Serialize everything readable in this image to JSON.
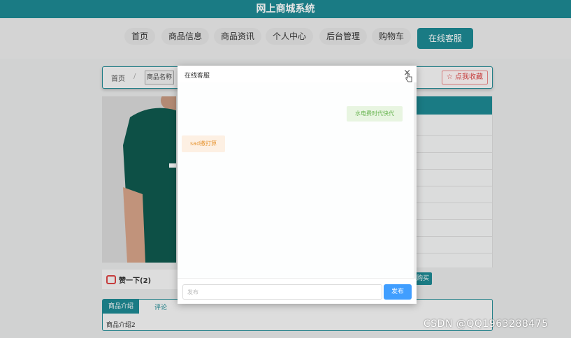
{
  "app": {
    "title": "网上商城系统"
  },
  "nav": {
    "items": [
      {
        "label": "首页"
      },
      {
        "label": "商品信息"
      },
      {
        "label": "商品资讯"
      },
      {
        "label": "个人中心"
      },
      {
        "label": "后台管理"
      },
      {
        "label": "购物车"
      },
      {
        "label": "在线客服"
      }
    ]
  },
  "breadcrumb": {
    "home": "首页",
    "sep": "/",
    "current": "商品名称"
  },
  "collect": {
    "label": "☆ 点我收藏"
  },
  "product": {
    "like_label": "赞一下(2)",
    "buy_label": "购买",
    "tabs": [
      {
        "label": "商品介绍"
      },
      {
        "label": "评论"
      }
    ],
    "intro": "商品介绍2"
  },
  "chat": {
    "title": "在线客服",
    "close_icon": "×",
    "messages": [
      {
        "side": "right",
        "text": "水电费时代快代"
      },
      {
        "side": "left",
        "text": "sad撒打算"
      }
    ],
    "input_placeholder": "发布",
    "send_label": "发布"
  },
  "watermark": "CSDN @QQ1963288475",
  "colors": {
    "accent": "#1e8a93",
    "send": "#409eff"
  }
}
